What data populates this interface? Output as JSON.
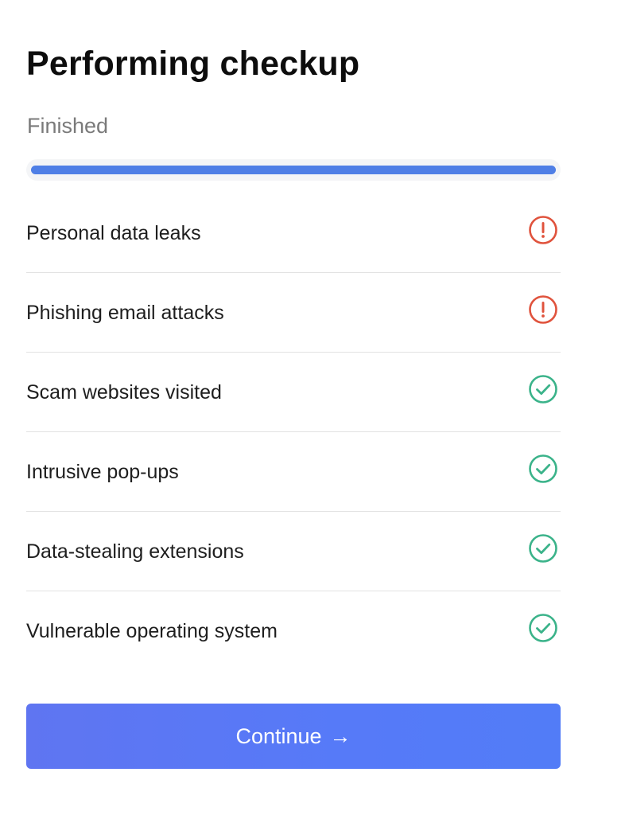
{
  "header": {
    "title": "Performing checkup",
    "status": "Finished"
  },
  "progress": {
    "value": 1.0
  },
  "checks": [
    {
      "label": "Personal data leaks",
      "status": "warning",
      "icon": "alert-circle-icon"
    },
    {
      "label": "Phishing email attacks",
      "status": "warning",
      "icon": "alert-circle-icon"
    },
    {
      "label": "Scam websites visited",
      "status": "ok",
      "icon": "check-circle-icon"
    },
    {
      "label": "Intrusive pop-ups",
      "status": "ok",
      "icon": "check-circle-icon"
    },
    {
      "label": "Data-stealing extensions",
      "status": "ok",
      "icon": "check-circle-icon"
    },
    {
      "label": "Vulnerable operating system",
      "status": "ok",
      "icon": "check-circle-icon"
    }
  ],
  "colors": {
    "progress": "#4f7fe6",
    "warning": "#e0533d",
    "ok": "#3bb38a",
    "button": "#567af8"
  },
  "continue_button": {
    "label": "Continue",
    "arrow": "→"
  }
}
